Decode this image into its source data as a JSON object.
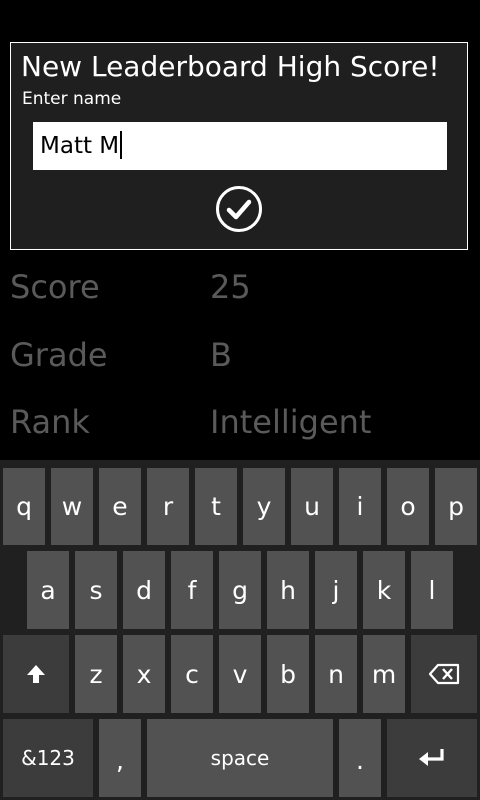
{
  "dialog": {
    "title": "New Leaderboard High Score!",
    "label": "Enter name",
    "input_value": "Matt M",
    "confirm_icon": "checkmark-circle-icon"
  },
  "stats": [
    {
      "label": "Score",
      "value": "25"
    },
    {
      "label": "Grade",
      "value": "B"
    },
    {
      "label": "Rank",
      "value": "Intelligent"
    }
  ],
  "keyboard": {
    "row1": [
      "q",
      "w",
      "e",
      "r",
      "t",
      "y",
      "u",
      "i",
      "o",
      "p"
    ],
    "row2": [
      "a",
      "s",
      "d",
      "f",
      "g",
      "h",
      "j",
      "k",
      "l"
    ],
    "row3": [
      "z",
      "x",
      "c",
      "v",
      "b",
      "n",
      "m"
    ],
    "shift_icon": "shift-arrow-icon",
    "backspace_icon": "backspace-icon",
    "symbols_label": "&123",
    "comma_label": ",",
    "space_label": "space",
    "period_label": ".",
    "enter_icon": "enter-icon"
  }
}
